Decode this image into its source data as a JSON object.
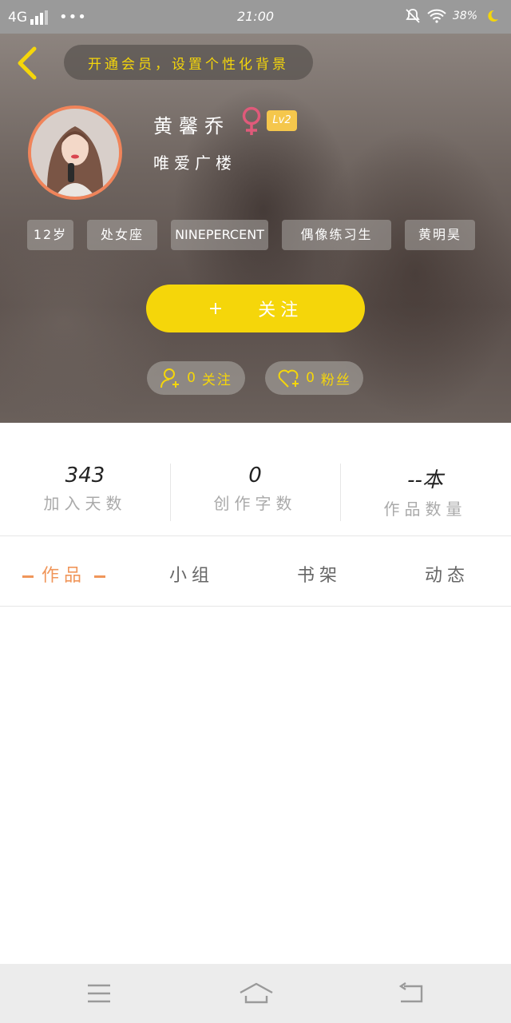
{
  "status_bar": {
    "network": "4G",
    "dots": "•••",
    "time": "21:00",
    "battery": "38%"
  },
  "header": {
    "vip_banner": "开通会员，设置个性化背景",
    "user": {
      "name": "黄馨乔",
      "level": "Lv2",
      "subtitle": "唯爱广楼"
    },
    "tags": [
      "12岁",
      "处女座",
      "NINEPERCENT",
      "偶像练习生",
      "黄明昊"
    ],
    "follow_button": {
      "icon": "+",
      "label": "关注"
    },
    "following": {
      "count": "0",
      "label": "关注"
    },
    "fans": {
      "count": "0",
      "label": "粉丝"
    }
  },
  "stats": [
    {
      "value": "343",
      "label": "加入天数"
    },
    {
      "value": "0",
      "label": "创作字数"
    },
    {
      "value": "--本",
      "label": "作品数量"
    }
  ],
  "tabs": [
    {
      "label": "作品",
      "active": true
    },
    {
      "label": "小组",
      "active": false
    },
    {
      "label": "书架",
      "active": false
    },
    {
      "label": "动态",
      "active": false
    }
  ],
  "colors": {
    "accent_yellow": "#f5d60a",
    "accent_orange": "#f0965a",
    "avatar_ring": "#f0845a",
    "gender_pink": "#e05a7a"
  }
}
